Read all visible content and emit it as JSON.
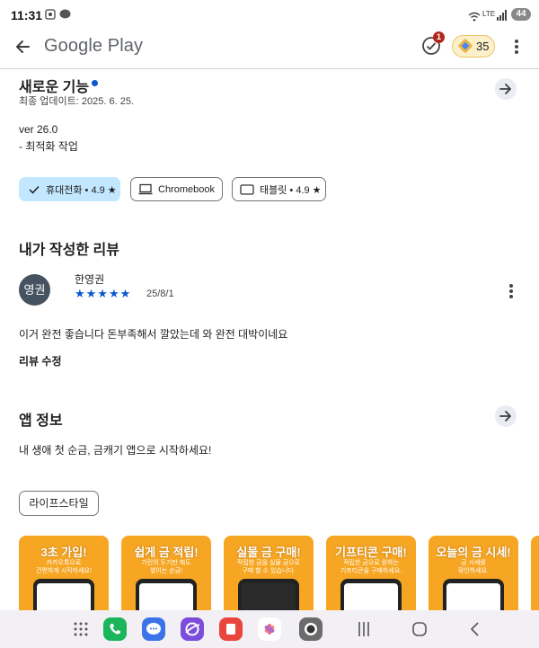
{
  "status_bar": {
    "time": "11:31",
    "battery": "44",
    "network": "LTE"
  },
  "app_bar": {
    "title": "Google Play",
    "notification_count": "1",
    "points": "35"
  },
  "whats_new": {
    "title": "새로운 기능",
    "updated": "최종 업데이트: 2025. 6. 25.",
    "version": "ver 26.0",
    "note": "- 최적화 작업"
  },
  "device_chips": [
    {
      "label": "휴대전화 • 4.9 ★",
      "icon": "check-icon",
      "selected": true
    },
    {
      "label": "Chromebook",
      "icon": "laptop-icon",
      "selected": false
    },
    {
      "label": "태블릿 • 4.9 ★",
      "icon": "tablet-icon",
      "selected": false
    }
  ],
  "my_review": {
    "heading": "내가 작성한 리뷰",
    "avatar_text": "영권",
    "author": "한영권",
    "stars": "★★★★★",
    "rating": 5,
    "date": "25/8/1",
    "body": "이거 완전 좋습니다 돈부족해서 깔았는데 와 완전 대박이네요",
    "edit_label": "리뷰 수정"
  },
  "app_info": {
    "heading": "앱 정보",
    "description": "내 생애 첫 순금, 금캐기 앱으로 시작하세요!",
    "category": "라이프스타일"
  },
  "screenshots": [
    {
      "title": "3초 가입!",
      "subtitle": "카카오톡으로\n간편하게 시작하세요!"
    },
    {
      "title": "쉽게 금 적립!",
      "subtitle": "기린의 두기만 해도\n쌓이는 순금!"
    },
    {
      "title": "실물 금 구매!",
      "subtitle": "적립한 금을 실물 금으로\n구매 할 수 있습니다."
    },
    {
      "title": "기프티콘 구매!",
      "subtitle": "적립한 금으로 원하는\n기프티콘을 구매하세요."
    },
    {
      "title": "오늘의 금 시세!",
      "subtitle": "금 시세를\n확인하세요."
    }
  ],
  "colors": {
    "accent_blue": "#0b57d0",
    "chip_selected": "#c2e7ff",
    "screenshot_orange": "#f6a623"
  }
}
